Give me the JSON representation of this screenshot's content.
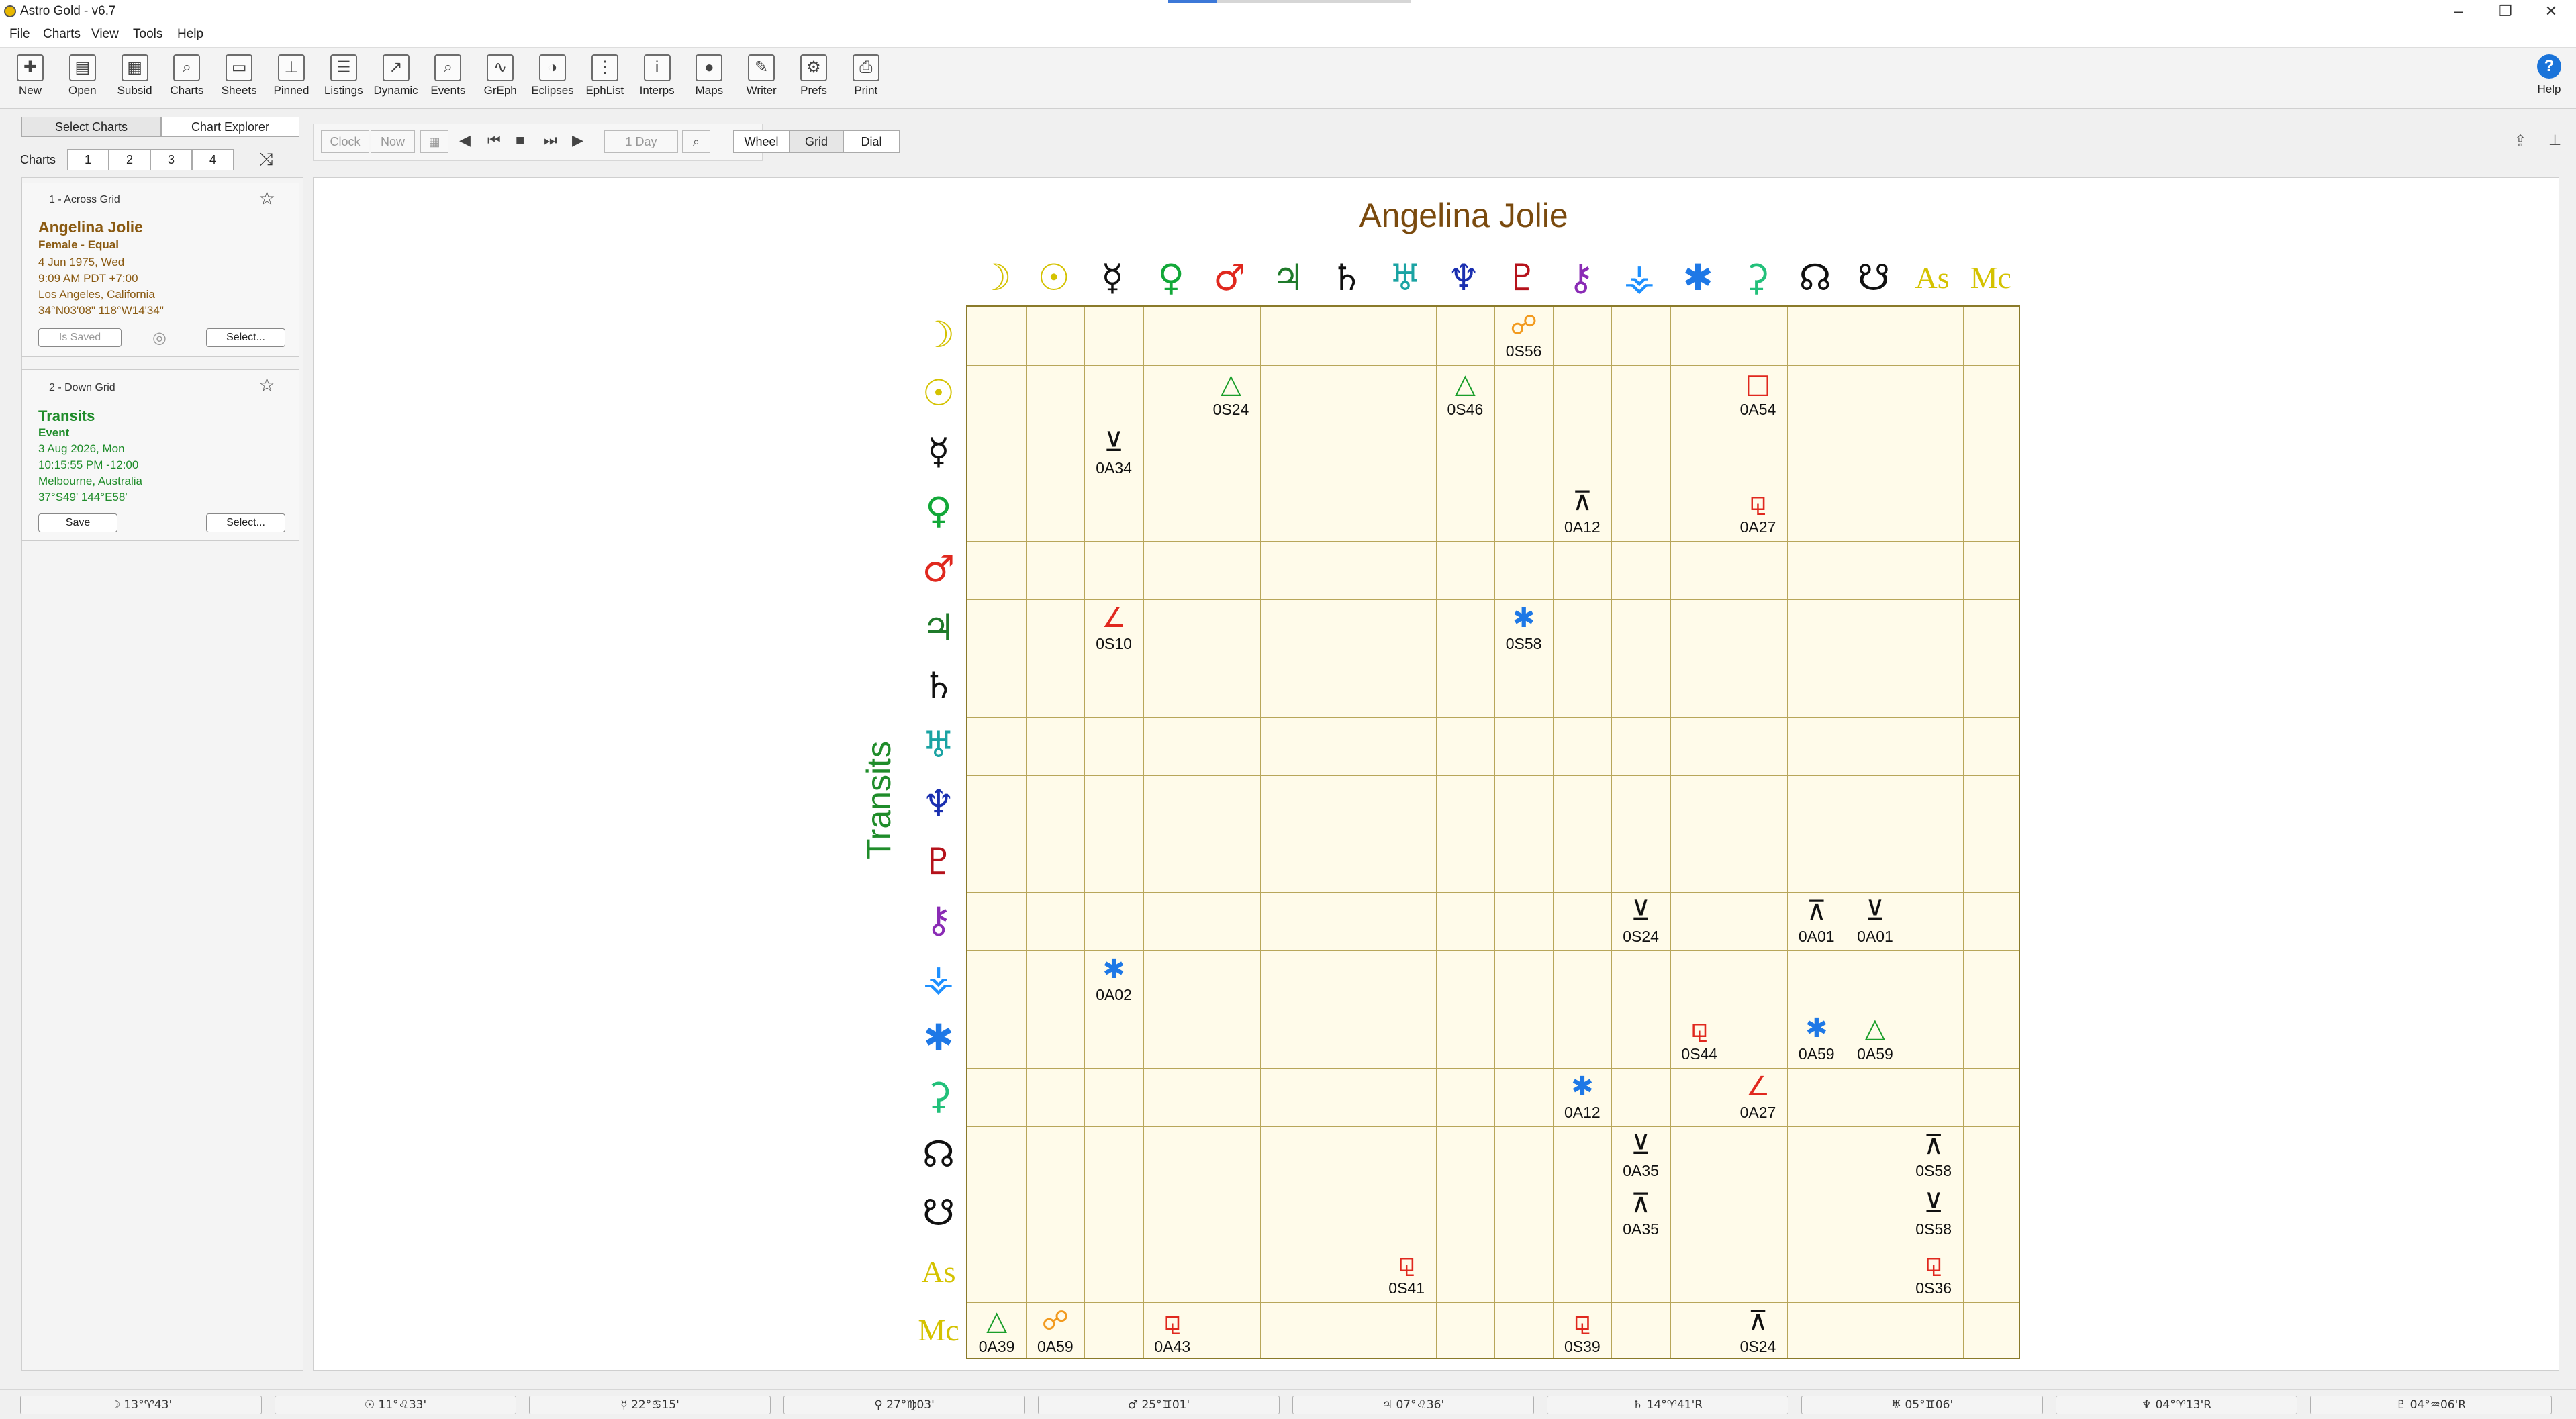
{
  "window": {
    "title": "Astro Gold - v6.7",
    "controls": [
      "–",
      "❐",
      "✕"
    ]
  },
  "menu": [
    "File",
    "Charts",
    "View",
    "Tools",
    "Help"
  ],
  "toolbar": [
    {
      "label": "New",
      "icon": "new-chart-icon",
      "glyph": "✚"
    },
    {
      "label": "Open",
      "icon": "open-icon",
      "glyph": "▤"
    },
    {
      "label": "Subsid",
      "icon": "subsid-icon",
      "glyph": "▦"
    },
    {
      "label": "Charts",
      "icon": "charts-icon",
      "glyph": "⌕"
    },
    {
      "label": "Sheets",
      "icon": "sheets-icon",
      "glyph": "▭"
    },
    {
      "label": "Pinned",
      "icon": "pin-icon",
      "glyph": "⊥"
    },
    {
      "label": "Listings",
      "icon": "listings-icon",
      "glyph": "☰"
    },
    {
      "label": "Dynamic",
      "icon": "dynamic-icon",
      "glyph": "↗"
    },
    {
      "label": "Events",
      "icon": "events-icon",
      "glyph": "⌕"
    },
    {
      "label": "GrEph",
      "icon": "graphic-ephemeris-icon",
      "glyph": "∿"
    },
    {
      "label": "Eclipses",
      "icon": "eclipses-icon",
      "glyph": "◑"
    },
    {
      "label": "EphList",
      "icon": "ephlist-icon",
      "glyph": "⋮"
    },
    {
      "label": "Interps",
      "icon": "info-icon",
      "glyph": "i"
    },
    {
      "label": "Maps",
      "icon": "globe-icon",
      "glyph": "●"
    },
    {
      "label": "Writer",
      "icon": "quill-icon",
      "glyph": "✎"
    },
    {
      "label": "Prefs",
      "icon": "gear-icon",
      "glyph": "⚙"
    },
    {
      "label": "Print",
      "icon": "printer-icon",
      "glyph": "⎙"
    }
  ],
  "help_button": {
    "label": "Help",
    "glyph": "?"
  },
  "left_tabs": [
    "Select Charts",
    "Chart Explorer"
  ],
  "charts_row": {
    "label": "Charts",
    "slots": [
      "1",
      "2",
      "3",
      "4"
    ],
    "shuffle": "⤨"
  },
  "nav_controls": {
    "clock": "Clock",
    "now": "Now",
    "step": "1 Day",
    "view_modes": [
      "Wheel",
      "Grid",
      "Dial"
    ]
  },
  "cards": [
    {
      "header": "1 - Across Grid",
      "name": "Angelina Jolie",
      "subtitle": "Female - Equal",
      "lines": [
        "4 Jun 1975, Wed",
        "9:09 AM PDT +7:00",
        "Los Angeles, California",
        "34°N03'08\" 118°W14'34\""
      ],
      "btn_left": "Is Saved",
      "btn_right": "Select...",
      "color": "#8a5a12"
    },
    {
      "header": "2 - Down Grid",
      "name": "Transits",
      "subtitle": "Event",
      "lines": [
        "3 Aug 2026, Mon",
        "10:15:55 PM -12:00",
        "Melbourne, Australia",
        "37°S49' 144°E58'"
      ],
      "btn_left": "Save",
      "btn_right": "Select...",
      "color": "#1f8c2a"
    }
  ],
  "grid": {
    "title": "Angelina Jolie",
    "side_label": "Transits",
    "points": [
      {
        "name": "Moon",
        "glyph": "☽",
        "color": "#d4c200"
      },
      {
        "name": "Sun",
        "glyph": "☉",
        "color": "#d4c200"
      },
      {
        "name": "Mercury",
        "glyph": "☿",
        "color": "#111111"
      },
      {
        "name": "Venus",
        "glyph": "♀",
        "color": "#12a838"
      },
      {
        "name": "Mars",
        "glyph": "♂",
        "color": "#e0281e"
      },
      {
        "name": "Jupiter",
        "glyph": "♃",
        "color": "#1f7a2a"
      },
      {
        "name": "Saturn",
        "glyph": "♄",
        "color": "#111111"
      },
      {
        "name": "Uranus",
        "glyph": "♅",
        "color": "#1aa3a3"
      },
      {
        "name": "Neptune",
        "glyph": "♆",
        "color": "#1a2fb0"
      },
      {
        "name": "Pluto",
        "glyph": "♇",
        "color": "#b5121b"
      },
      {
        "name": "Chiron",
        "glyph": "⚷",
        "color": "#8a2bb5"
      },
      {
        "name": "Vesta",
        "glyph": "⚶",
        "color": "#1e90ff"
      },
      {
        "name": "Juno",
        "glyph": "✱",
        "color": "#1e78e6"
      },
      {
        "name": "Ceres",
        "glyph": "⚳",
        "color": "#22c07a"
      },
      {
        "name": "North Node",
        "glyph": "☊",
        "color": "#111111"
      },
      {
        "name": "South Node",
        "glyph": "☋",
        "color": "#111111"
      },
      {
        "name": "Ascendant",
        "glyph": "As",
        "color": "#d4c200"
      },
      {
        "name": "Midheaven",
        "glyph": "Mc",
        "color": "#d4c200"
      }
    ],
    "aspects": [
      {
        "row": 0,
        "col": 9,
        "glyph": "☍",
        "color": "#f29a1e",
        "orb": "0S56"
      },
      {
        "row": 1,
        "col": 4,
        "glyph": "△",
        "color": "#1a9e2a",
        "orb": "0S24"
      },
      {
        "row": 1,
        "col": 8,
        "glyph": "△",
        "color": "#1a9e2a",
        "orb": "0S46"
      },
      {
        "row": 1,
        "col": 13,
        "glyph": "□",
        "color": "#e0281e",
        "orb": "0A54"
      },
      {
        "row": 2,
        "col": 2,
        "glyph": "⊻",
        "color": "#111111",
        "orb": "0A34"
      },
      {
        "row": 3,
        "col": 10,
        "glyph": "⊼",
        "color": "#111111",
        "orb": "0A12"
      },
      {
        "row": 3,
        "col": 13,
        "glyph": "⚼",
        "color": "#e0281e",
        "orb": "0A27"
      },
      {
        "row": 5,
        "col": 2,
        "glyph": "∠",
        "color": "#e0281e",
        "orb": "0S10"
      },
      {
        "row": 5,
        "col": 9,
        "glyph": "✱",
        "color": "#1e78e6",
        "orb": "0S58"
      },
      {
        "row": 10,
        "col": 11,
        "glyph": "⊻",
        "color": "#111111",
        "orb": "0S24"
      },
      {
        "row": 10,
        "col": 14,
        "glyph": "⊼",
        "color": "#111111",
        "orb": "0A01"
      },
      {
        "row": 10,
        "col": 15,
        "glyph": "⊻",
        "color": "#111111",
        "orb": "0A01"
      },
      {
        "row": 11,
        "col": 2,
        "glyph": "✱",
        "color": "#1e78e6",
        "orb": "0A02"
      },
      {
        "row": 12,
        "col": 12,
        "glyph": "⚼",
        "color": "#e0281e",
        "orb": "0S44"
      },
      {
        "row": 12,
        "col": 14,
        "glyph": "✱",
        "color": "#1e78e6",
        "orb": "0A59"
      },
      {
        "row": 12,
        "col": 15,
        "glyph": "△",
        "color": "#1a9e2a",
        "orb": "0A59"
      },
      {
        "row": 13,
        "col": 10,
        "glyph": "✱",
        "color": "#1e78e6",
        "orb": "0A12"
      },
      {
        "row": 13,
        "col": 13,
        "glyph": "∠",
        "color": "#e0281e",
        "orb": "0A27"
      },
      {
        "row": 14,
        "col": 11,
        "glyph": "⊻",
        "color": "#111111",
        "orb": "0A35"
      },
      {
        "row": 14,
        "col": 16,
        "glyph": "⊼",
        "color": "#111111",
        "orb": "0S58"
      },
      {
        "row": 15,
        "col": 11,
        "glyph": "⊼",
        "color": "#111111",
        "orb": "0A35"
      },
      {
        "row": 15,
        "col": 16,
        "glyph": "⊻",
        "color": "#111111",
        "orb": "0S58"
      },
      {
        "row": 16,
        "col": 7,
        "glyph": "⚼",
        "color": "#e0281e",
        "orb": "0S41"
      },
      {
        "row": 16,
        "col": 16,
        "glyph": "⚼",
        "color": "#e0281e",
        "orb": "0S36"
      },
      {
        "row": 17,
        "col": 0,
        "glyph": "△",
        "color": "#1a9e2a",
        "orb": "0A39"
      },
      {
        "row": 17,
        "col": 1,
        "glyph": "☍",
        "color": "#f29a1e",
        "orb": "0A59"
      },
      {
        "row": 17,
        "col": 3,
        "glyph": "⚼",
        "color": "#e0281e",
        "orb": "0A43"
      },
      {
        "row": 17,
        "col": 10,
        "glyph": "⚼",
        "color": "#e0281e",
        "orb": "0S39"
      },
      {
        "row": 17,
        "col": 13,
        "glyph": "⊼",
        "color": "#111111",
        "orb": "0S24"
      }
    ]
  },
  "status_bar": [
    "☽ 13°♈43'",
    "☉ 11°♌33'",
    "☿ 22°♋15'",
    "♀ 27°♍03'",
    "♂ 25°♊01'",
    "♃ 07°♌36'",
    "♄ 14°♈41'R",
    "♅ 05°♊06'",
    "♆ 04°♈13'R",
    "♇ 04°♒06'R"
  ]
}
